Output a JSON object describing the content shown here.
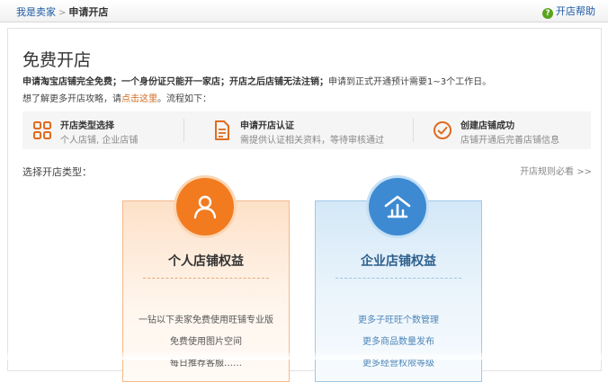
{
  "breadcrumb": {
    "home": "我是卖家",
    "separator": ">",
    "current": "申请开店"
  },
  "help": {
    "icon": "question-icon",
    "label": "开店帮助"
  },
  "page": {
    "title": "免费开店",
    "intro_bold": "申请淘宝店铺完全免费；一个身份证只能开一家店；开店之后店铺无法注销；",
    "intro_rest": "申请到正式开通预计需要1~3个工作日。",
    "more_prefix": "想了解更多开店攻略，请",
    "more_link": "点击这里",
    "more_suffix": "。流程如下："
  },
  "steps": [
    {
      "icon": "grid-icon",
      "title": "开店类型选择",
      "desc": "个人店铺, 企业店铺"
    },
    {
      "icon": "document-icon",
      "title": "申请开店认证",
      "desc": "需提供认证相关资料，等待审核通过"
    },
    {
      "icon": "check-circle-icon",
      "title": "创建店铺成功",
      "desc": "店铺开通后完善店铺信息"
    }
  ],
  "choose_label": "选择开店类型：",
  "rules_link": "开店规则必看 >>",
  "cards": {
    "personal": {
      "icon": "person-icon",
      "title": "个人店铺权益",
      "features": [
        "一钻以下卖家免费使用旺铺专业版",
        "免费使用图片空间",
        "每日推荐客服……"
      ]
    },
    "enterprise": {
      "icon": "enterprise-icon",
      "title": "企业店铺权益",
      "features": [
        "更多子旺旺个数管理",
        "更多商品数量发布",
        "更多经营权限等级"
      ]
    }
  },
  "colors": {
    "link": "#1c5aa6",
    "orange_accent": "#f27b20",
    "blue_accent": "#3d8ad2",
    "step_icon": "#e06b1f"
  }
}
